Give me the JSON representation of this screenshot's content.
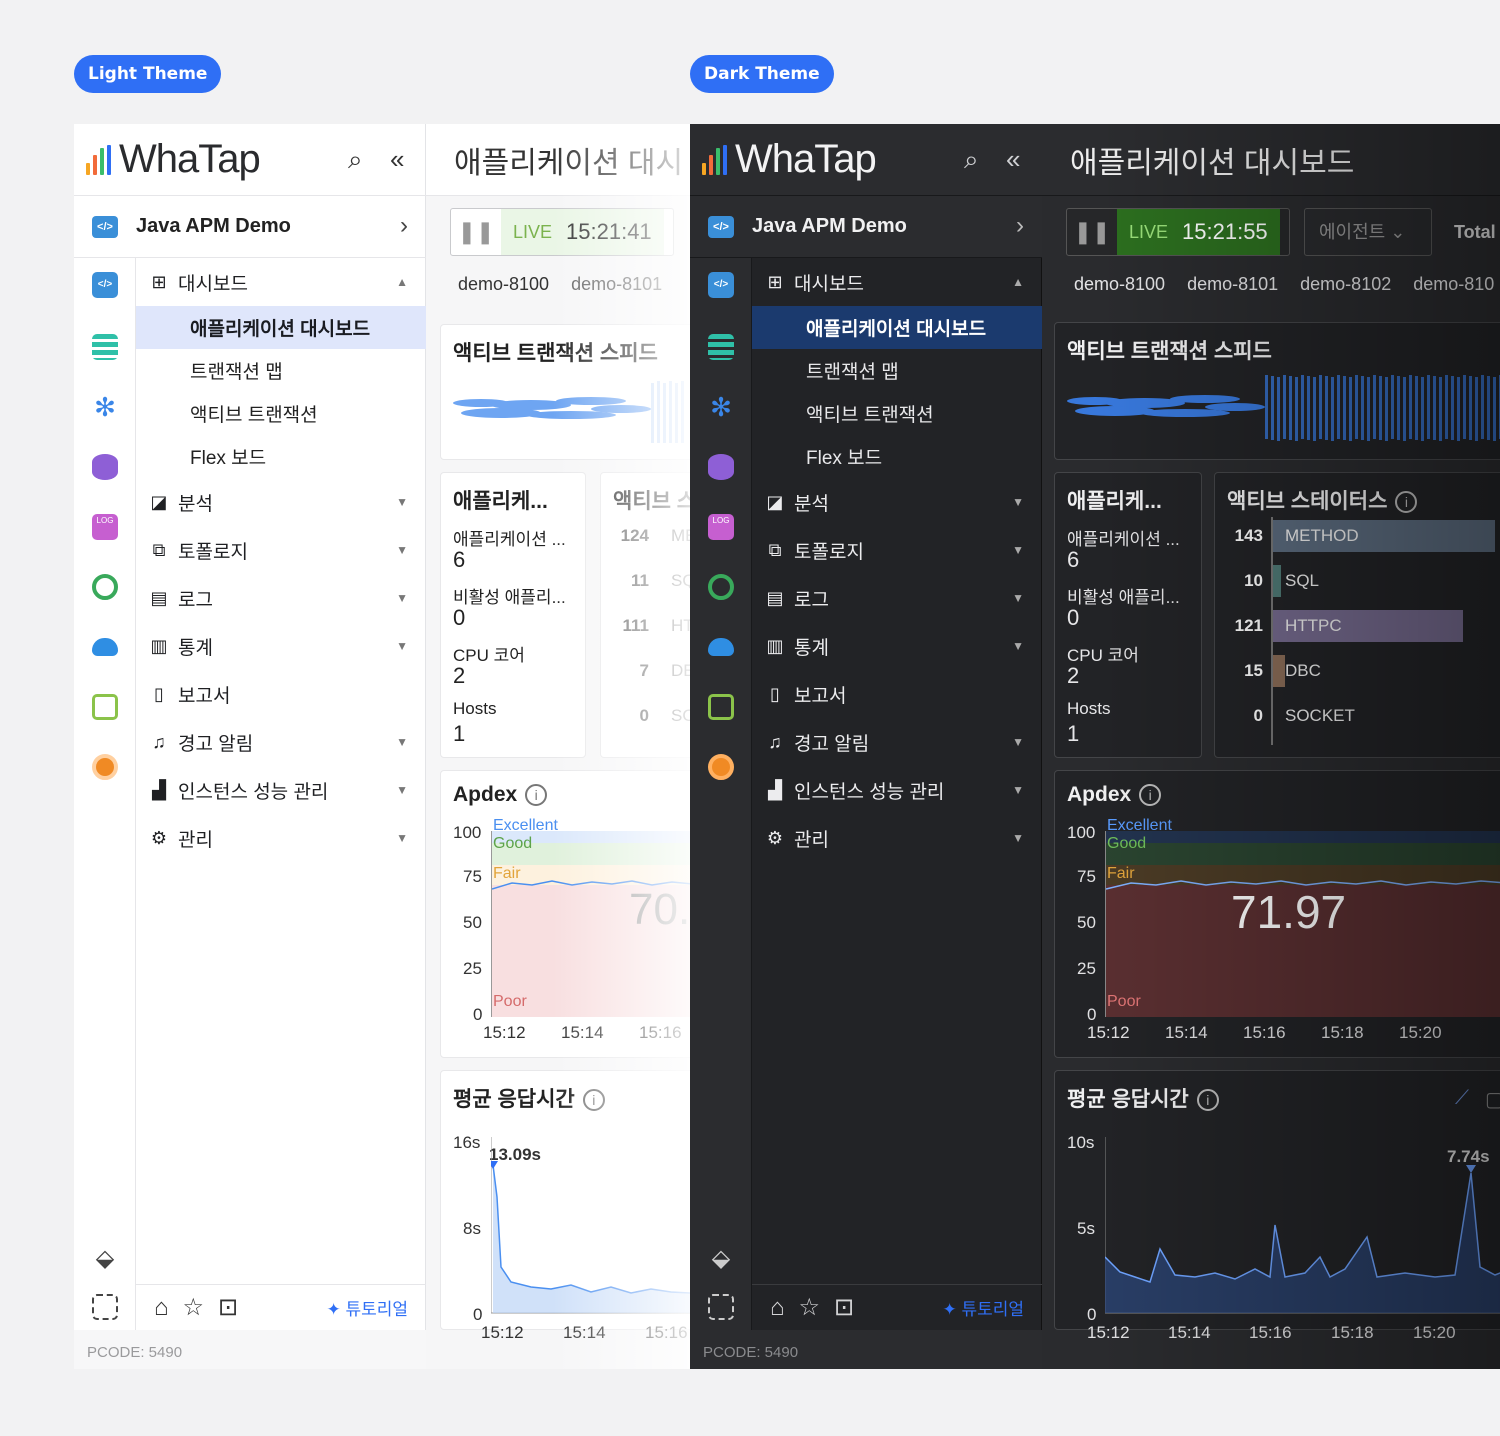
{
  "light_label": "Light Theme",
  "dark_label": "Dark Theme",
  "brand": {
    "name": "WhaTap",
    "bar_colors": [
      "#f6a623",
      "#f26b3a",
      "#3bbd6b",
      "#2f6ff5"
    ]
  },
  "project": {
    "name": "Java APM Demo",
    "icon": "code-icon"
  },
  "menu": {
    "dashboard": "대시보드",
    "subs": [
      "애플리케이션 대시보드",
      "트랜잭션 맵",
      "액티브 트랜잭션",
      "Flex 보드"
    ],
    "items": [
      "분석",
      "토폴로지",
      "로그",
      "통계",
      "보고서",
      "경고 알림",
      "인스턴스 성능 관리",
      "관리"
    ]
  },
  "tutorial": "튜토리얼",
  "pcode": "PCODE: 5490",
  "light": {
    "title": "애플리케이션 대시",
    "live": "LIVE",
    "time": "15:21:41",
    "tabs": [
      "demo-8100",
      "demo-8101"
    ],
    "apdex_big": "70.",
    "apdex_x": [
      "15:12",
      "15:14",
      "15:16"
    ],
    "resp_x": [
      "15:12",
      "15:14",
      "15:16"
    ],
    "resp_y": [
      "16s",
      "8s",
      "0"
    ],
    "resp_peak": "13.09s",
    "as_title": "액티브 스",
    "as_nums": [
      "124",
      "11",
      "111",
      "7",
      "0"
    ],
    "as_lbls": [
      "ME",
      "SQ",
      "HT",
      "DE",
      "SO"
    ]
  },
  "dark": {
    "title": "애플리케이션 대시보드",
    "live": "LIVE",
    "time": "15:21:55",
    "agent": "에이전트",
    "total": "Total",
    "tabs": [
      "demo-8100",
      "demo-8101",
      "demo-8102",
      "demo-810"
    ],
    "apdex_big": "71.97",
    "apdex_x": [
      "15:12",
      "15:14",
      "15:16",
      "15:18",
      "15:20"
    ],
    "resp_x": [
      "15:12",
      "15:14",
      "15:16",
      "15:18",
      "15:20"
    ],
    "resp_y": [
      "10s",
      "5s",
      "0"
    ],
    "resp_peak": "7.74s",
    "as_title": "액티브 스테이터스",
    "as_nums": [
      "143",
      "10",
      "121",
      "15",
      "0"
    ],
    "as_lbls": [
      "METHOD",
      "SQL",
      "HTTPC",
      "DBC",
      "SOCKET"
    ]
  },
  "cards": {
    "speed": "액티브 트랜잭션 스피드",
    "app": "애플리케...",
    "stats": [
      {
        "label": "애플리케이션 ...",
        "value": "6"
      },
      {
        "label": "비활성 애플리...",
        "value": "0"
      },
      {
        "label": "CPU 코어",
        "value": "2"
      },
      {
        "label": "Hosts",
        "value": "1"
      }
    ],
    "apdex": "Apdex",
    "apdex_y": [
      "100",
      "75",
      "50",
      "25",
      "0"
    ],
    "zones": [
      "Excellent",
      "Good",
      "Fair",
      "Poor"
    ],
    "resp": "평균 응답시간"
  },
  "colors": {
    "accent": "#2f6ff5",
    "live_green": "#7bb34e"
  }
}
